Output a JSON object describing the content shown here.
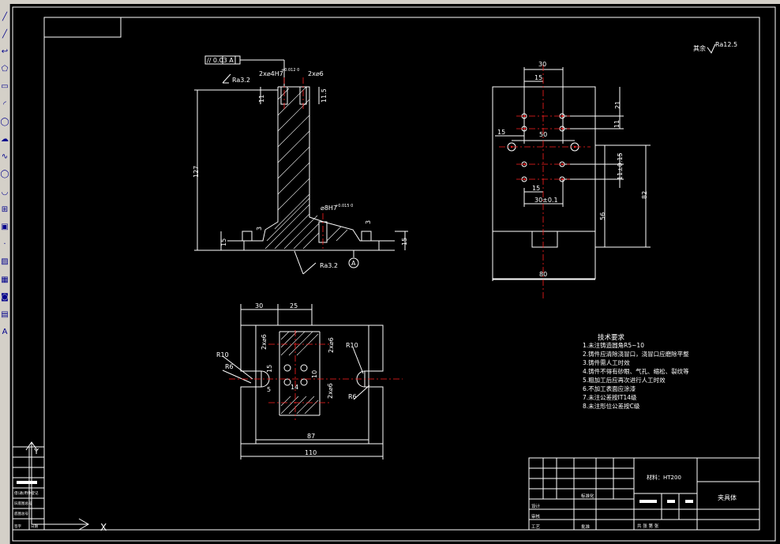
{
  "toolbar": {
    "tools": [
      "line-tool",
      "construction-line-tool",
      "polyline-tool",
      "polygon-tool",
      "rectangle-tool",
      "arc-tool",
      "circle-tool",
      "revision-cloud-tool",
      "spline-tool",
      "ellipse-tool",
      "ellipse-arc-tool",
      "insert-block-tool",
      "make-block-tool",
      "point-tool",
      "hatch-tool",
      "gradient-tool",
      "region-tool",
      "table-tool",
      "multiline-text-tool"
    ],
    "glyphs": [
      "╱",
      "╱",
      "↩",
      "⬠",
      "▭",
      "◜",
      "◯",
      "☁",
      "∿",
      "◯",
      "◡",
      "⊞",
      "▣",
      "·",
      "▨",
      "▦",
      "◙",
      "▤",
      "A"
    ]
  },
  "drawing": {
    "roughness_note": "其余",
    "roughness_main": "Ra12.5",
    "front_view": {
      "flatness": "// 0.03 A",
      "ra_top": "Ra3.2",
      "holes_left": "2x⌀4H7",
      "holes_left_tol": "+0.012 0",
      "holes_right": "2x⌀6",
      "dim_11": "11",
      "dim_12": "11.5",
      "height_127": "127",
      "base_15_left": "15",
      "base_3_left": "3",
      "base_3_right": "3",
      "base_15_right": "15",
      "center_hole": "⌀8H7",
      "center_hole_tol": "+0.015 0",
      "ra_bottom": "Ra3.2",
      "datum": "A"
    },
    "side_view": {
      "dim_30": "30",
      "dim_15_top": "15",
      "dim_21": "21",
      "dim_11": "11",
      "dim_15_left": "15",
      "dim_50": "50",
      "dim_11_tol": "11±0.15",
      "dim_15_mid": "15",
      "dim_30_tol": "30±0.1",
      "dim_56": "56",
      "dim_82": "82",
      "dim_80": "80"
    },
    "top_view": {
      "dim_30": "30",
      "dim_25": "25",
      "r10_left": "R10",
      "r6_left": "R6",
      "r10_right": "R10",
      "r6_right": "R6",
      "hole_a": "2x⌀6",
      "hole_b": "2x⌀6",
      "hole_c": "2x⌀6",
      "dim_15": "15",
      "dim_10": "10",
      "dim_14": "14",
      "dim_5": "5",
      "dim_87": "87",
      "dim_110": "110"
    },
    "tech_req": {
      "title": "技术要求",
      "items": [
        "1.未注铸造圆角R5~10",
        "2.铸件应清除浇冒口，浇冒口应磨除平整",
        "3.铸件需人工时效",
        "4.铸件不得有砂眼、气孔、缩松、裂纹等",
        "5.粗加工后应再次进行人工时效",
        "6.不加工表面应涂漆",
        "7.未注公差按IT14级",
        "8.未注形位公差按C级"
      ]
    },
    "title_block": {
      "material": "材料：HT200",
      "part_name": "夹具体",
      "design": "设计",
      "check": "审核",
      "process": "工艺",
      "standard": "标准化",
      "approve": "批准",
      "sheets": "共  张    第  张"
    },
    "left_block": {
      "labels": [
        "借(通)用件登记",
        "旧底图总号",
        "底图总号",
        "签字",
        "日期"
      ]
    },
    "ucs": {
      "x": "X",
      "y": "Y"
    }
  }
}
